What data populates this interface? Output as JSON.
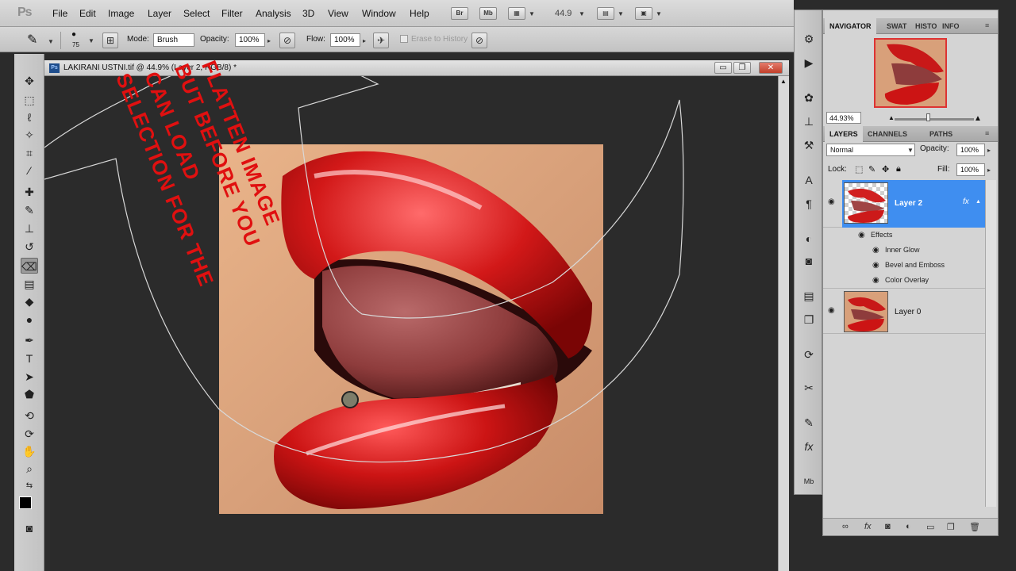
{
  "app": {
    "logo": "Ps"
  },
  "menu": [
    "File",
    "Edit",
    "Image",
    "Layer",
    "Select",
    "Filter",
    "Analysis",
    "3D",
    "View",
    "Window",
    "Help"
  ],
  "menubar_buttons": {
    "bridge": "Br",
    "minibridge": "Mb",
    "zoom_value": "44.9"
  },
  "options": {
    "brush_size": "75",
    "mode_label": "Mode:",
    "mode_value": "Brush",
    "opacity_label": "Opacity:",
    "opacity_value": "100%",
    "flow_label": "Flow:",
    "flow_value": "100%",
    "erase_history": "Erase to History"
  },
  "document": {
    "title": "LAKIRANI USTNI.tif @ 44.9% (Layer 2, RGB/8) *",
    "btn_minimize": "▭",
    "btn_restore": "❐",
    "btn_close": "✕"
  },
  "annotation": {
    "line1": "FLATTEN IMAGE",
    "line2": "BUT BEFORE YOU",
    "line3": "CAN LOAD",
    "line4": "SELECTION FOR THE"
  },
  "navigator": {
    "tabs": [
      "NAVIGATOR",
      "SWAT",
      "HISTO",
      "INFO"
    ],
    "zoom": "44.93%"
  },
  "layers": {
    "tabs": [
      "LAYERS",
      "CHANNELS",
      "PATHS"
    ],
    "blend_mode": "Normal",
    "opacity_label": "Opacity:",
    "opacity_value": "100%",
    "lock_label": "Lock:",
    "fill_label": "Fill:",
    "fill_value": "100%",
    "items": [
      {
        "name": "Layer 2",
        "selected": true,
        "fx": "fx"
      },
      {
        "name": "Layer 0",
        "selected": false
      }
    ],
    "effects_label": "Effects",
    "effects": [
      "Inner Glow",
      "Bevel and Emboss",
      "Color Overlay"
    ]
  },
  "colors": {
    "accent_selected": "#3f8ef0",
    "annotation": "#e01010",
    "canvas_bg": "#2b2b2b"
  }
}
